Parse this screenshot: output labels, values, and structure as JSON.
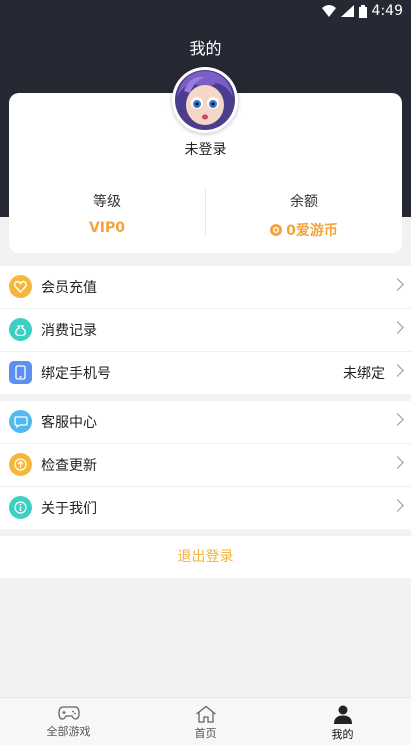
{
  "status_bar": {
    "time": "4:49"
  },
  "header": {
    "title": "我的"
  },
  "profile": {
    "username": "未登录",
    "level_label": "等级",
    "level_value": "VIP0",
    "balance_label": "余额",
    "balance_value": "0爱游币"
  },
  "menu_group_1": [
    {
      "label": "会员充值",
      "icon": "vip-recharge-icon",
      "color": "#f6b63a"
    },
    {
      "label": "消费记录",
      "icon": "bag-icon",
      "color": "#3ccfc2"
    },
    {
      "label": "绑定手机号",
      "icon": "phone-icon",
      "color": "#5b8ff2",
      "value": "未绑定"
    }
  ],
  "menu_group_2": [
    {
      "label": "客服中心",
      "icon": "chat-icon",
      "color": "#52b8f0"
    },
    {
      "label": "检查更新",
      "icon": "upload-icon",
      "color": "#f6b63a"
    },
    {
      "label": "关于我们",
      "icon": "info-icon",
      "color": "#3ccfc2"
    }
  ],
  "logout_label": "退出登录",
  "tabbar": [
    {
      "label": "全部游戏",
      "icon": "gamepad-icon"
    },
    {
      "label": "首页",
      "icon": "home-icon"
    },
    {
      "label": "我的",
      "icon": "user-icon",
      "active": true
    }
  ],
  "colors": {
    "header_bg": "#262833",
    "accent": "#f4a53a",
    "logout": "#f4b23b"
  }
}
